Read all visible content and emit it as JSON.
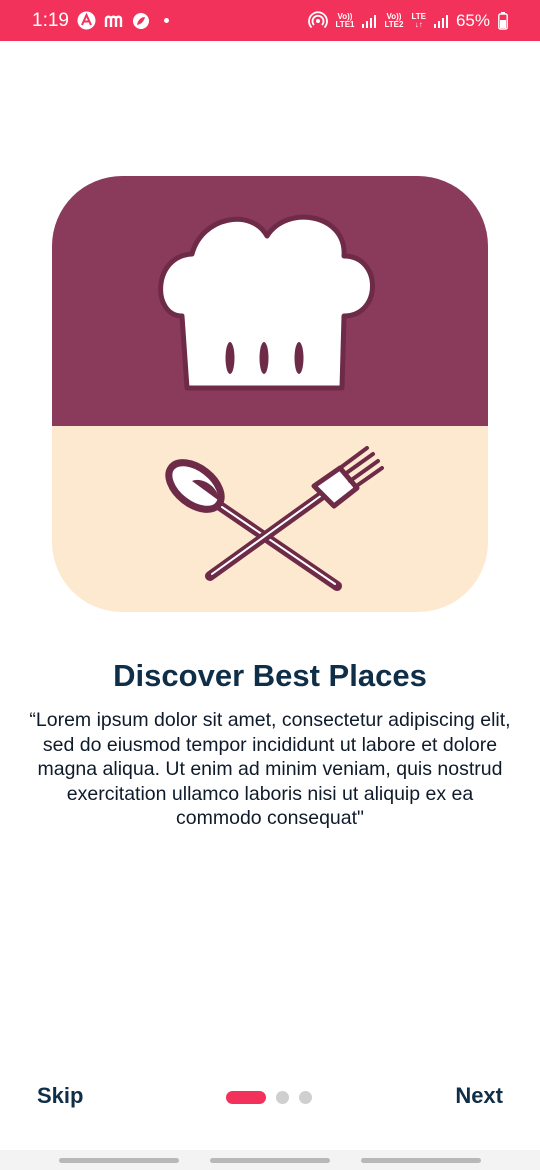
{
  "status_bar": {
    "time": "1:19",
    "sim1_label_top": "Vo))",
    "sim1_label_bottom": "LTE1",
    "sim2_label_top": "Vo))",
    "sim2_label_bottom": "LTE2",
    "lte_label": "LTE",
    "battery": "65%"
  },
  "onboarding": {
    "title": "Discover Best Places",
    "description": "“Lorem ipsum dolor sit amet, consectetur adipiscing elit, sed do eiusmod tempor incididunt ut labore et dolore magna aliqua. Ut enim ad minim veniam, quis nostrud exercitation ullamco laboris nisi ut aliquip ex ea commodo consequat\"",
    "current_page": 1,
    "total_pages": 3
  },
  "footer": {
    "skip_label": "Skip",
    "next_label": "Next"
  },
  "colors": {
    "accent": "#f2325a",
    "title": "#0f2e48",
    "icon_top": "#8a3a5a",
    "icon_bottom": "#fde9cf",
    "icon_stroke": "#6e2b48"
  }
}
